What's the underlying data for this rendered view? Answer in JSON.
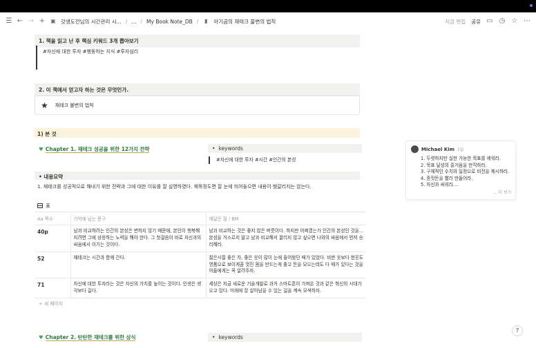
{
  "nav": {
    "breadcrumb_1": "갓생도전님의 시간관리 시...",
    "ellipsis": "...",
    "breadcrumb_2": "My Book Note_DB",
    "breadcrumb_3": "아기곰의 재테크 불변의 법칙",
    "edited": "지금 편집",
    "share": "공유"
  },
  "section1": {
    "title": "1.  책을 읽고 난 후 핵심 키워드 3개 뽑아보기",
    "tags": "#자신에 대한 투자  #행동하는 지식  #투자심리"
  },
  "section2": {
    "title": "2.  이 책에서 얻고자 하는 것은 무엇인가.",
    "callout": "재테크 불변의 법칙"
  },
  "section_main": {
    "title": "1) 본 것"
  },
  "chapter1": {
    "title": "Chapter 1. 재테크 성공을 위한 12가지 전략",
    "keywords_label": "keywords",
    "keywords_tags": "#자신에 대한 투자 #시간 #인간의 본성"
  },
  "summary": {
    "label": "내용요약",
    "text": "1.  재테크를 성공적으로 해내기 위한 전략과 그에 대한 이유를 잘 설명하였다. 제목정도면 잘 눈에 띄어놓으면 내용이 헷갈리지는 않는다."
  },
  "table": {
    "title": "표",
    "columns": [
      "Aa 쪽수",
      "기억에 남는 문구",
      "깨달은 점 / BM"
    ],
    "rows": [
      {
        "page": "40p",
        "quote": "남과 비교하려는 인간의 본성은 변하지 않기 때문에, 본인이 행복해지려면 그에 상응하는 노력을 해야 한다. 그 첫걸음이 바로 자신과의 싸움에서 이기는 것이다.",
        "insight": "남과 비교하는 것은 좋지 않은 버릇이다. 하지만 어쩌겠는가 인간의 본성인 것을... 본성을 거스르지 말고 남과 비교해서 꿀리지 않고 싶으면 나와의 싸움에서 먼저 승리해라."
      },
      {
        "page": "52",
        "quote": "재테크는 시간과 함께 간다.",
        "insight": "젊은시절 좋은 차, 좋은 옷이 많이 눈에 들어왔던 때가 있었다. 비싼 옷보다 현웃도 명품으로 보이게끔 멋진 몸을 만드는게 좋고 돈을 모으는데도 다 때가 있다는 것을 아들에게는 꼭 알려주자."
      },
      {
        "page": "71",
        "quote": "자신에 대한 투자라는 것은 자신의 가치를 높이는 것이다. 인생은 생각보다 길다.",
        "insight": "세상은 지금 새로운 기술개발로 과거 스마트폰이 가져온 것과 같은 혁신의 시대가 오고 있다. 미래에 잘 살아남을 수 있는 길을 계속 모색하자."
      }
    ],
    "new_page": "+ 새 페이지"
  },
  "chapter2": {
    "title": "Chapter 2. 탄탄한 재테크를 위한 상식",
    "keywords_label": "keywords"
  },
  "comment": {
    "author": "Michael Kim",
    "time": "1일",
    "items": [
      "1. 두렷하지만 실현 가능한 목표를 세워라.",
      "2. 목표 달성의 즐거움을 만끽하라.",
      "3. 구체적인 수치와 일정으로 비전을 제시하라.",
      "4. 종잣돈을 빨리 만들어라.",
      "5. 자신과 싸워라...."
    ],
    "more": "... 더 보기"
  },
  "icons": {
    "menu": "menu-icon",
    "back": "arrow-left-icon",
    "forward": "arrow-right-icon",
    "add": "plus-icon",
    "comment": "comment-icon",
    "history": "clock-icon",
    "favorite": "star-icon",
    "more": "more-icon"
  }
}
